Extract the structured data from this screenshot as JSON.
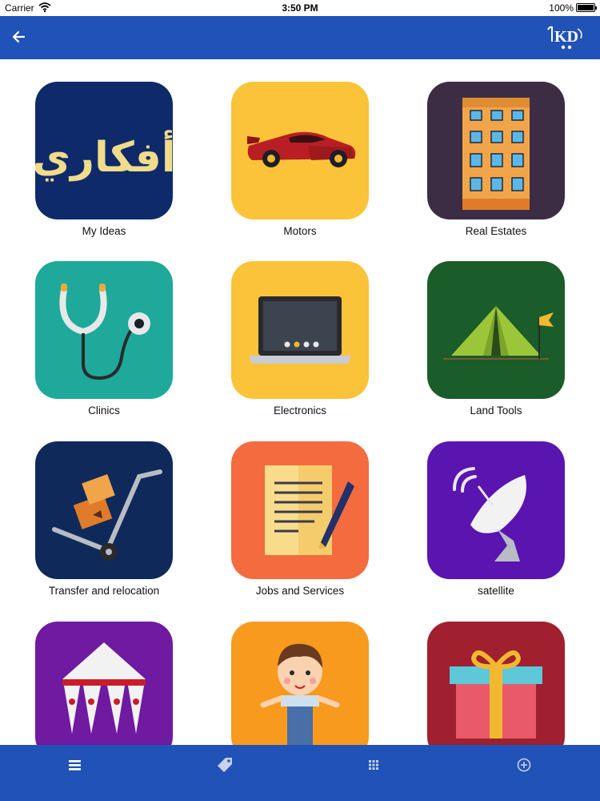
{
  "status_bar": {
    "carrier": "Carrier",
    "time": "3:50 PM",
    "battery": "100%"
  },
  "nav": {
    "logo_text": "KD"
  },
  "categories": [
    {
      "label": "My Ideas",
      "icon": "my-ideas-icon",
      "bg": "#0f2a6b",
      "art_text": "أفكاري"
    },
    {
      "label": "Motors",
      "icon": "car-icon",
      "bg": "#fbc339"
    },
    {
      "label": "Real Estates",
      "icon": "building-icon",
      "bg": "#3c2d45"
    },
    {
      "label": "Clinics",
      "icon": "stethoscope-icon",
      "bg": "#1ea99b"
    },
    {
      "label": "Electronics",
      "icon": "laptop-icon",
      "bg": "#fbc339"
    },
    {
      "label": "Land Tools",
      "icon": "tent-icon",
      "bg": "#1a5c2a"
    },
    {
      "label": "Transfer and relocation",
      "icon": "hand-truck-icon",
      "bg": "#0f2a5a"
    },
    {
      "label": "Jobs and Services",
      "icon": "document-pen-icon",
      "bg": "#f36b3f"
    },
    {
      "label": "satellite",
      "icon": "satellite-dish-icon",
      "bg": "#5a14b0"
    },
    {
      "label": "",
      "icon": "canopy-tent-icon",
      "bg": "#6f1aa0"
    },
    {
      "label": "",
      "icon": "child-icon",
      "bg": "#f79a1e"
    },
    {
      "label": "",
      "icon": "gift-icon",
      "bg": "#a0202f"
    }
  ],
  "tab_bar": {
    "items": [
      {
        "icon": "menu-icon"
      },
      {
        "icon": "tag-icon"
      },
      {
        "icon": "grid-icon"
      },
      {
        "icon": "add-circle-icon"
      }
    ]
  }
}
